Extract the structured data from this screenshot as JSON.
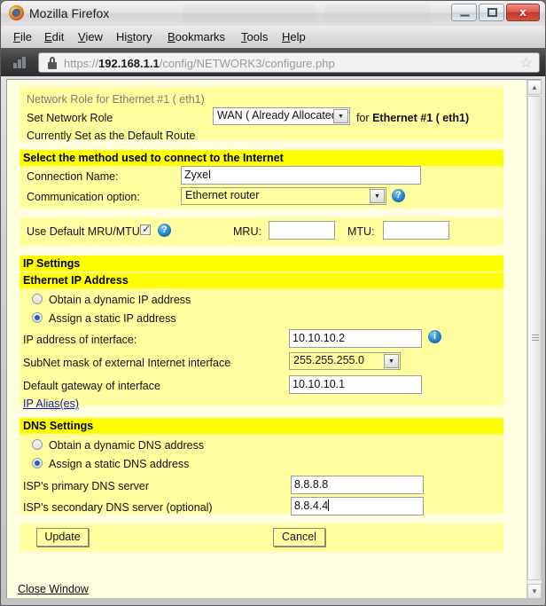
{
  "window": {
    "title": "Mozilla Firefox",
    "caption_buttons": {
      "minimize": "minimize-icon",
      "maximize": "maximize-icon",
      "close": "x"
    }
  },
  "menubar": {
    "items": [
      {
        "pre": "",
        "key": "F",
        "post": "ile"
      },
      {
        "pre": "",
        "key": "E",
        "post": "dit"
      },
      {
        "pre": "",
        "key": "V",
        "post": "iew"
      },
      {
        "pre": "Hi",
        "key": "s",
        "post": "tory"
      },
      {
        "pre": "",
        "key": "B",
        "post": "ookmarks"
      },
      {
        "pre": "",
        "key": "T",
        "post": "ools"
      },
      {
        "pre": "",
        "key": "H",
        "post": "elp"
      }
    ]
  },
  "navbar": {
    "lock_icon": "lock-icon",
    "chart_icon": "chart-icon",
    "star_icon": "☆",
    "url_scheme": "https://",
    "url_host": "192.168.1.1",
    "url_path": "/config/NETWORK3/configure.php"
  },
  "scrollbar": {
    "up_arrow": "▲",
    "down_arrow": "▼"
  },
  "page": {
    "role_section": {
      "title": "Network Role for Ethernet #1 ( eth1)",
      "set_role_label": "Set Network Role",
      "role_value": "WAN ( Already Allocated)",
      "role_suffix_prefix": "for",
      "role_suffix_bold": "Ethernet #1 ( eth1)",
      "default_route_note": "Currently Set as the Default Route",
      "dropdown_arrow": "▼"
    },
    "method_section": {
      "header": "Select the method used to connect to the Internet",
      "connection_name_label": "Connection Name:",
      "connection_name_value": "Zyxel",
      "communication_label": "Communication option:",
      "communication_value": "Ethernet router",
      "help_icon": "?",
      "dropdown_arrow": "▼"
    },
    "mru_section": {
      "use_default_label": "Use Default MRU/MTU:",
      "checkbox_checked": true,
      "help_icon": "?",
      "mru_label": "MRU:",
      "mru_value": "",
      "mtu_label": "MTU:",
      "mtu_value": ""
    },
    "ip_settings": {
      "header": "IP Settings",
      "subheader": "Ethernet IP Address",
      "radio_dynamic_label": "Obtain a dynamic IP address",
      "radio_static_label": "Assign a static IP address",
      "selected": "static",
      "ip_label": "IP address of interface:",
      "ip_value": "10.10.10.2",
      "info_icon": "i",
      "subnet_label": "SubNet mask of external Internet interface",
      "subnet_value": "255.255.255.0",
      "gateway_label": "Default gateway of interface",
      "gateway_value": "10.10.10.1",
      "alias_link": "IP Alias(es)",
      "dropdown_arrow": "▼"
    },
    "dns_settings": {
      "header": "DNS Settings",
      "radio_dynamic_label": "Obtain a dynamic DNS address",
      "radio_static_label": "Assign a static DNS address",
      "selected": "static",
      "primary_label": "ISP's primary DNS server",
      "primary_value": "8.8.8.8",
      "secondary_label": "ISP's secondary DNS server (optional)",
      "secondary_value": "8.8.4.4"
    },
    "actions": {
      "update_label": "Update",
      "cancel_label": "Cancel",
      "close_window_link": "Close Window"
    }
  },
  "colors": {
    "header_yellow": "#ffff00",
    "panel_yellow": "#ffffa0",
    "page_bg": "#ffffdf",
    "link_blue": "#1414c8",
    "accent_blue": "#2f8fd8"
  }
}
